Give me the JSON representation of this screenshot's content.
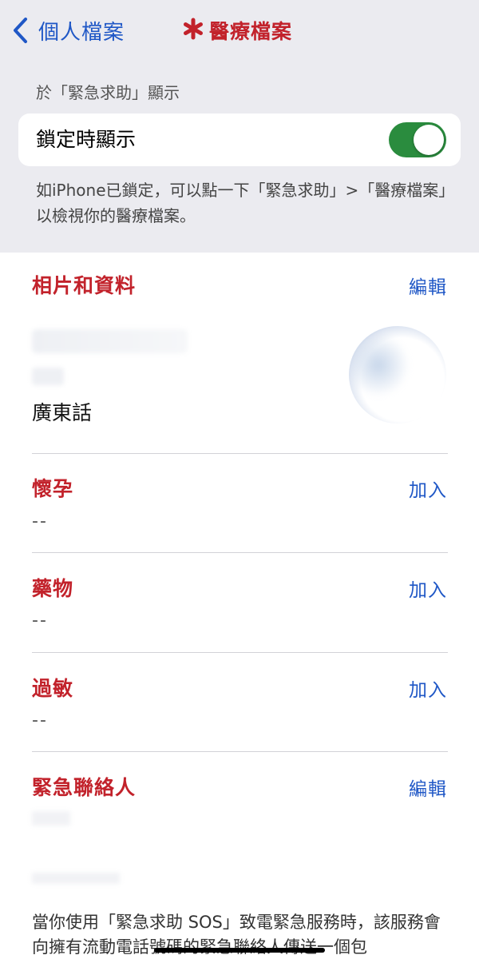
{
  "nav": {
    "back_label": "個人檔案",
    "title": "醫療檔案",
    "title_symbol": "✱",
    "colors": {
      "back": "#1f57c6",
      "title": "#c2222b"
    },
    "back_icon": "chevron-left-icon"
  },
  "emergency": {
    "section_header": "於「緊急求助」顯示",
    "lock_label": "鎖定時顯示",
    "lock_toggle_on": true,
    "footer_note": "如iPhone已鎖定，可以點一下「緊急求助」>「醫療檔案」以檢視你的醫療檔案。",
    "toggle_color": "#2a8c3e"
  },
  "profile": {
    "title": "相片和資料",
    "action": "編輯",
    "language": "廣東話"
  },
  "sections": [
    {
      "title": "懷孕",
      "action": "加入",
      "value": "--"
    },
    {
      "title": "藥物",
      "action": "加入",
      "value": "--"
    },
    {
      "title": "過敏",
      "action": "加入",
      "value": "--"
    }
  ],
  "contacts": {
    "title": "緊急聯絡人",
    "action": "編輯"
  },
  "bottom_text": "當你使用「緊急求助 SOS」致電緊急服務時，該服務會向擁有流動電話號碼的緊急聯絡人傳送一個包"
}
